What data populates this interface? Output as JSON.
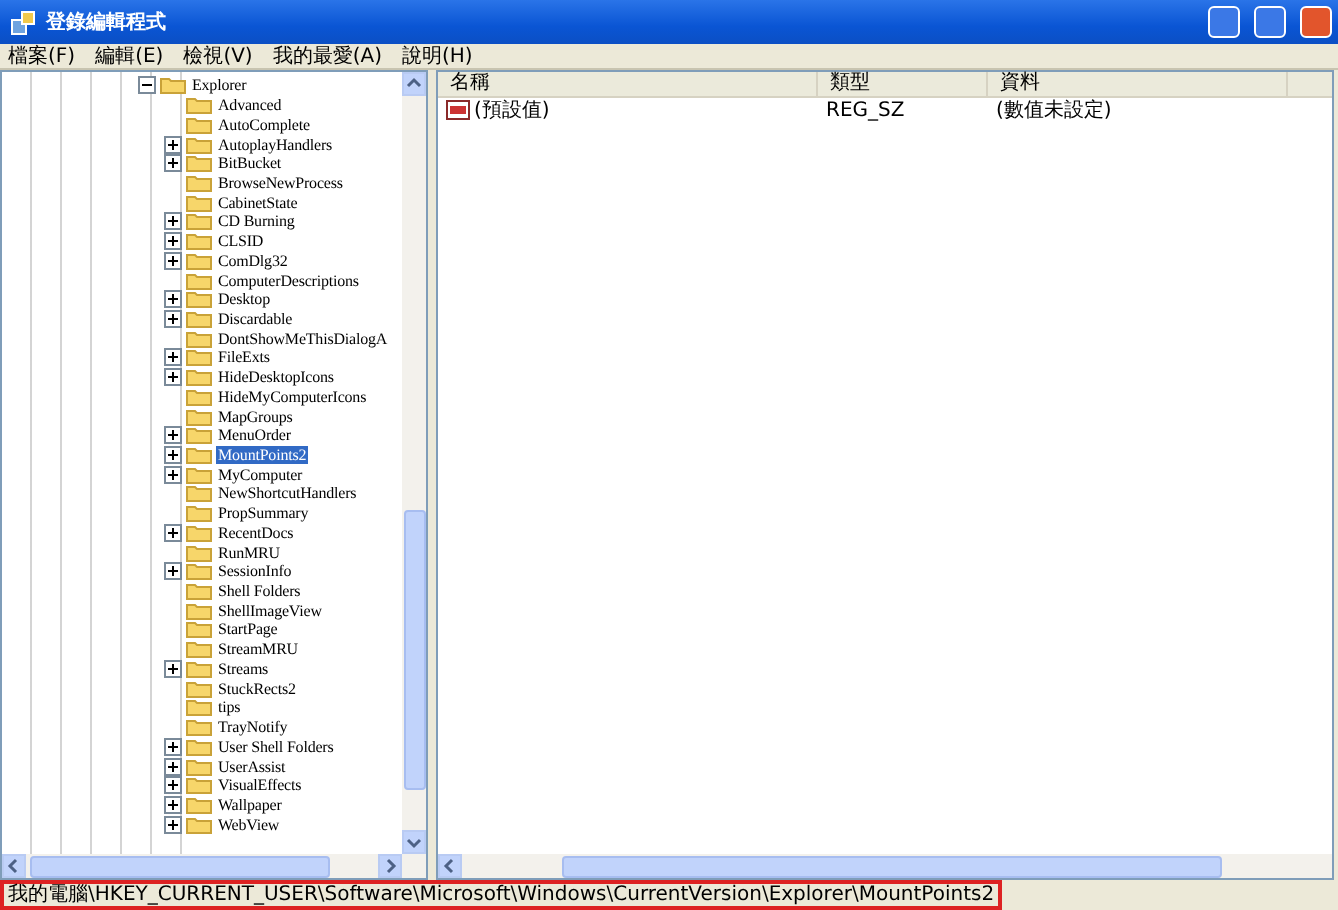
{
  "window": {
    "title": "登錄編輯程式"
  },
  "menu": [
    {
      "label": "檔案(F)"
    },
    {
      "label": "編輯(E)"
    },
    {
      "label": "檢視(V)"
    },
    {
      "label": "我的最愛(A)"
    },
    {
      "label": "說明(H)"
    }
  ],
  "tree": [
    {
      "label": "Explorer",
      "expanded": true,
      "selected": false,
      "children": [
        {
          "label": "Advanced",
          "expandable": false,
          "selected": false
        },
        {
          "label": "AutoComplete",
          "expandable": false,
          "selected": false
        },
        {
          "label": "AutoplayHandlers",
          "expandable": true,
          "selected": false
        },
        {
          "label": "BitBucket",
          "expandable": true,
          "selected": false
        },
        {
          "label": "BrowseNewProcess",
          "expandable": false,
          "selected": false
        },
        {
          "label": "CabinetState",
          "expandable": false,
          "selected": false
        },
        {
          "label": "CD Burning",
          "expandable": true,
          "selected": false
        },
        {
          "label": "CLSID",
          "expandable": true,
          "selected": false
        },
        {
          "label": "ComDlg32",
          "expandable": true,
          "selected": false
        },
        {
          "label": "ComputerDescriptions",
          "expandable": false,
          "selected": false
        },
        {
          "label": "Desktop",
          "expandable": true,
          "selected": false
        },
        {
          "label": "Discardable",
          "expandable": true,
          "selected": false
        },
        {
          "label": "DontShowMeThisDialogA",
          "expandable": false,
          "selected": false
        },
        {
          "label": "FileExts",
          "expandable": true,
          "selected": false
        },
        {
          "label": "HideDesktopIcons",
          "expandable": true,
          "selected": false
        },
        {
          "label": "HideMyComputerIcons",
          "expandable": false,
          "selected": false
        },
        {
          "label": "MapGroups",
          "expandable": false,
          "selected": false
        },
        {
          "label": "MenuOrder",
          "expandable": true,
          "selected": false
        },
        {
          "label": "MountPoints2",
          "expandable": true,
          "selected": true
        },
        {
          "label": "MyComputer",
          "expandable": true,
          "selected": false
        },
        {
          "label": "NewShortcutHandlers",
          "expandable": false,
          "selected": false
        },
        {
          "label": "PropSummary",
          "expandable": false,
          "selected": false
        },
        {
          "label": "RecentDocs",
          "expandable": true,
          "selected": false
        },
        {
          "label": "RunMRU",
          "expandable": false,
          "selected": false
        },
        {
          "label": "SessionInfo",
          "expandable": true,
          "selected": false
        },
        {
          "label": "Shell Folders",
          "expandable": false,
          "selected": false
        },
        {
          "label": "ShellImageView",
          "expandable": false,
          "selected": false
        },
        {
          "label": "StartPage",
          "expandable": false,
          "selected": false
        },
        {
          "label": "StreamMRU",
          "expandable": false,
          "selected": false
        },
        {
          "label": "Streams",
          "expandable": true,
          "selected": false
        },
        {
          "label": "StuckRects2",
          "expandable": false,
          "selected": false
        },
        {
          "label": "tips",
          "expandable": false,
          "selected": false
        },
        {
          "label": "TrayNotify",
          "expandable": false,
          "selected": false
        },
        {
          "label": "User Shell Folders",
          "expandable": true,
          "selected": false
        },
        {
          "label": "UserAssist",
          "expandable": true,
          "selected": false
        },
        {
          "label": "VisualEffects",
          "expandable": true,
          "selected": false
        },
        {
          "label": "Wallpaper",
          "expandable": true,
          "selected": false
        },
        {
          "label": "WebView",
          "expandable": true,
          "selected": false
        }
      ]
    }
  ],
  "table": {
    "columns": [
      "名稱",
      "類型",
      "資料"
    ],
    "rows": [
      {
        "name": "(預設值)",
        "type": "REG_SZ",
        "data": "(數值未設定)"
      }
    ]
  },
  "status_bar": "我的電腦\\HKEY_CURRENT_USER\\Software\\Microsoft\\Windows\\CurrentVersion\\Explorer\\MountPoints2"
}
